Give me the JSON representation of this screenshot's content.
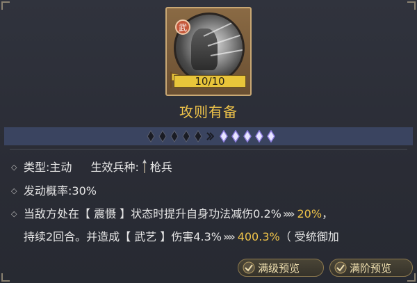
{
  "skill": {
    "type_badge": "武",
    "level_text": "10/10",
    "name": "攻则有备"
  },
  "stars": {
    "dark_count": 5,
    "bright_count": 5
  },
  "details": {
    "type_label": "类型:主动",
    "troop_label": "生效兵种:",
    "troop_value": "枪兵",
    "rate_label": "发动概率:30%",
    "desc_part1": "当敌方处在【 震慑 】状态时提升自身功法减伤0.2%",
    "desc_value1": "20%",
    "desc_comma": "，",
    "desc_part2": "持续2回合。并造成【 武艺 】伤害4.3%",
    "desc_value2": "400.3%",
    "desc_part3": "（ 受统御加"
  },
  "buttons": {
    "full_level": "满级预览",
    "full_rank": "满阶预览"
  },
  "colors": {
    "accent": "#f0c44a",
    "bar": "#3a4460"
  }
}
